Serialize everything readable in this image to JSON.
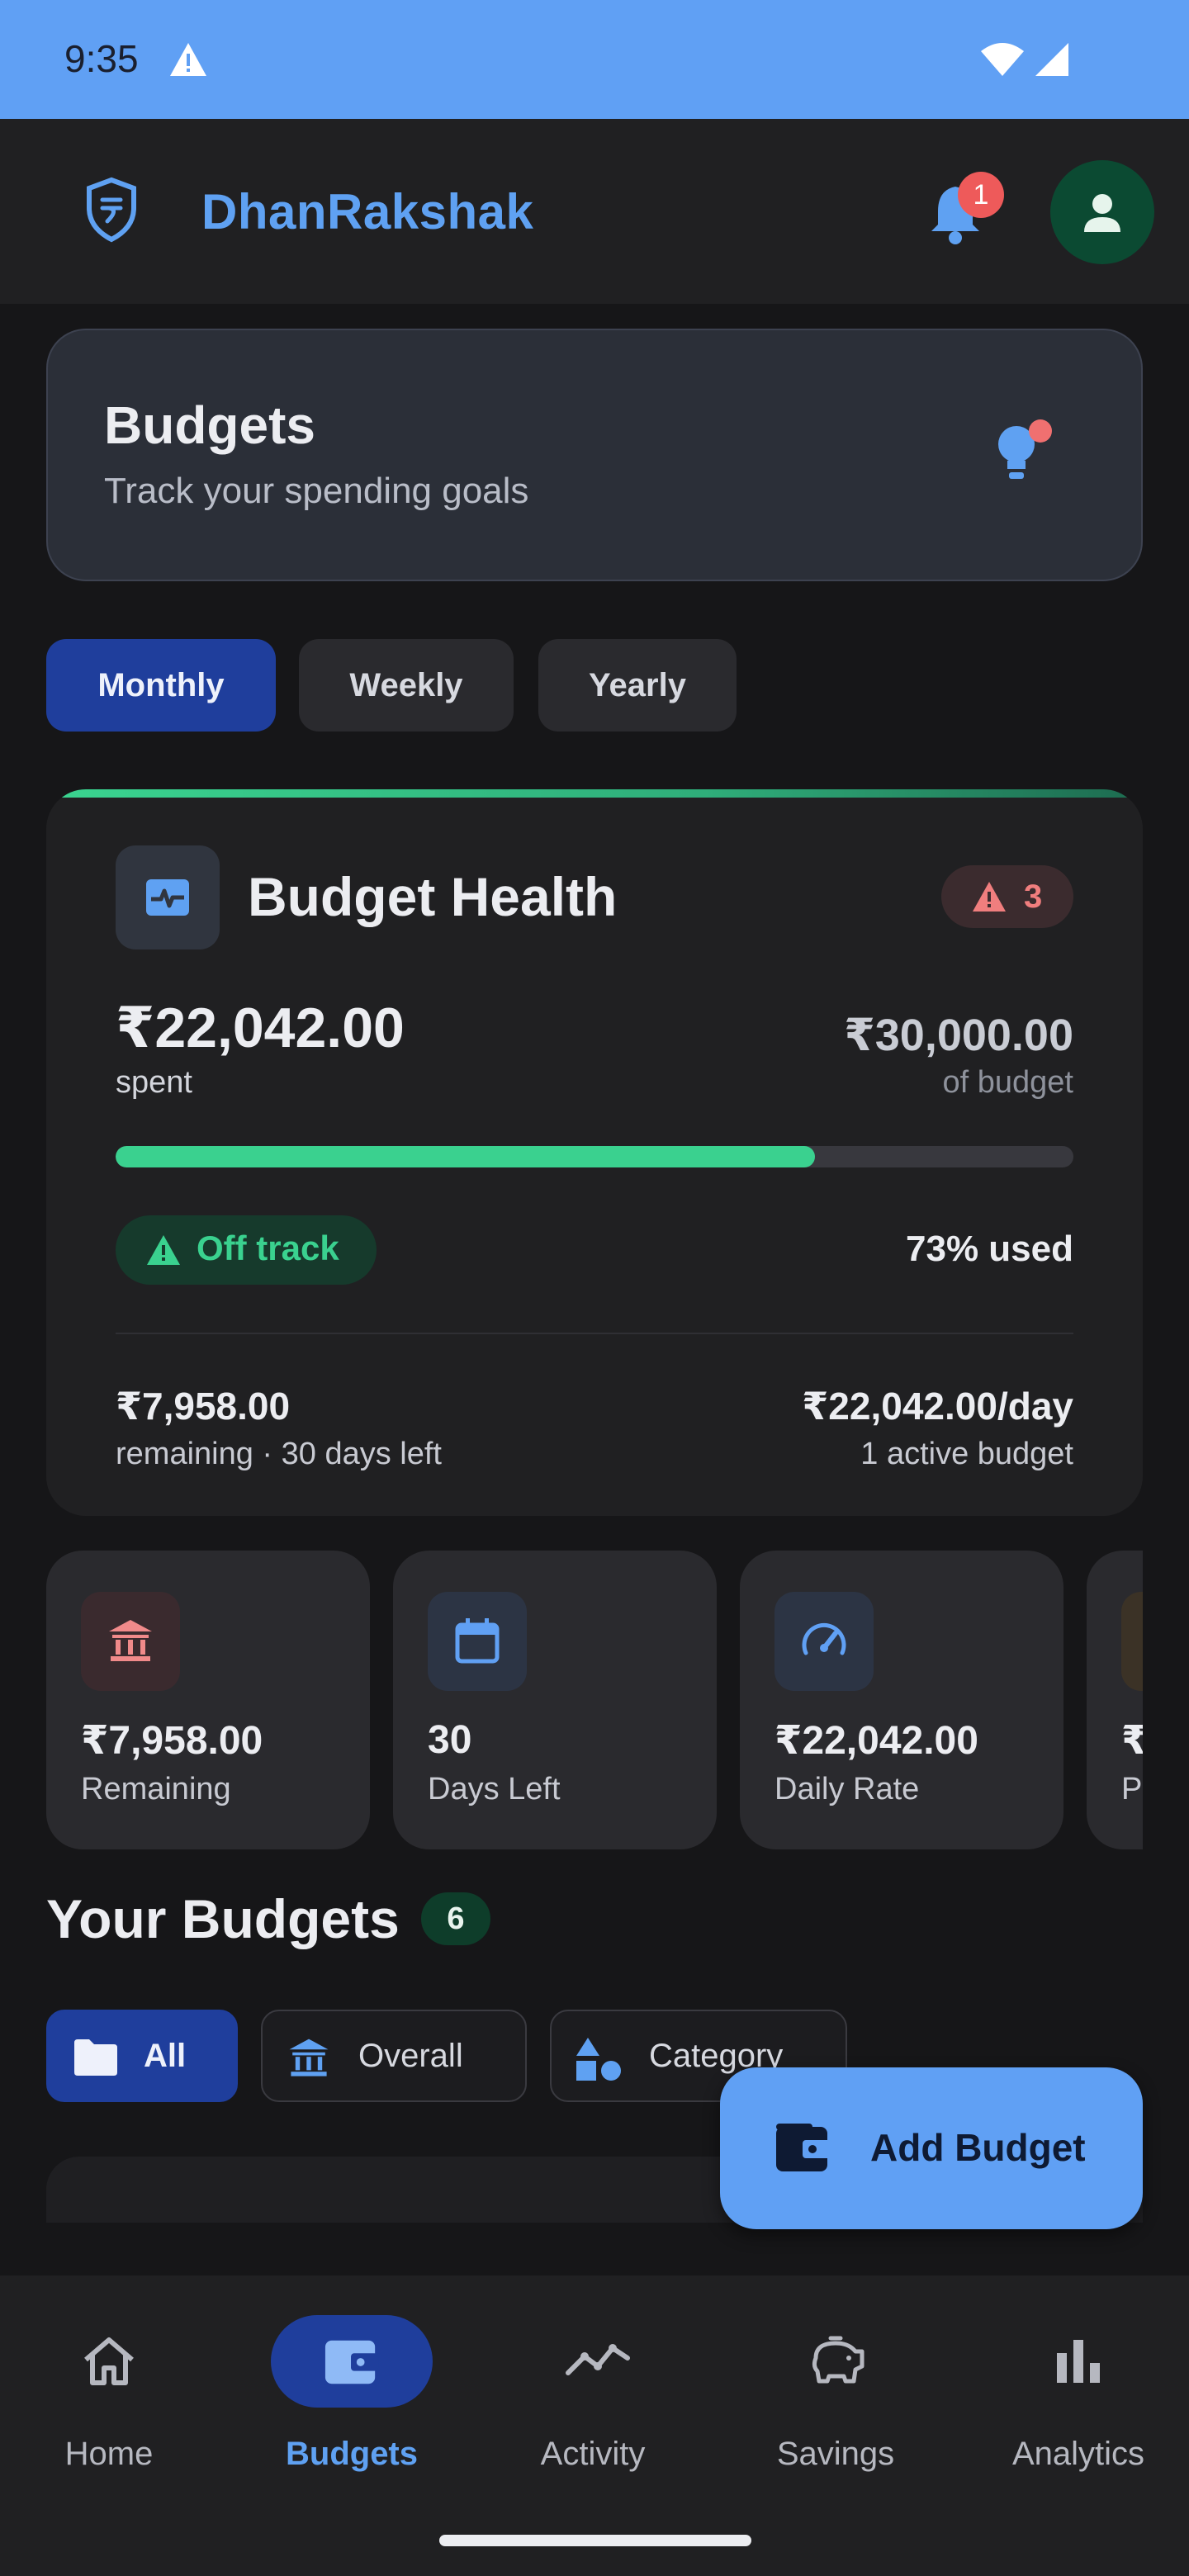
{
  "status_bar": {
    "time": "9:35"
  },
  "app": {
    "title": "DhanRakshak",
    "notification_count": "1"
  },
  "header": {
    "title": "Budgets",
    "subtitle": "Track your spending goals"
  },
  "period_tabs": [
    {
      "label": "Monthly",
      "active": true
    },
    {
      "label": "Weekly",
      "active": false
    },
    {
      "label": "Yearly",
      "active": false
    }
  ],
  "health": {
    "title": "Budget Health",
    "alert_count": "3",
    "spent": "₹22,042.00",
    "spent_label": "spent",
    "budget": "₹30,000.00",
    "budget_label": "of budget",
    "progress_fraction": 0.73,
    "status": "Off track",
    "used": "73% used",
    "remaining": "₹7,958.00",
    "remaining_sub": "remaining · 30 days left",
    "daily_rate": "₹22,042.00/day",
    "active_budgets": "1 active budget"
  },
  "stats": [
    {
      "value": "₹7,958.00",
      "label": "Remaining",
      "icon": "bank-icon",
      "bg": "#3a2a2e",
      "color": "#f08a8a"
    },
    {
      "value": "30",
      "label": "Days Left",
      "icon": "calendar-icon",
      "bg": "#2c3444",
      "color": "#60a0f4"
    },
    {
      "value": "₹22,042.00",
      "label": "Daily Rate",
      "icon": "speedometer-icon",
      "bg": "#2c3444",
      "color": "#60a0f4"
    },
    {
      "value": "₹",
      "label": "P",
      "icon": "misc-icon",
      "bg": "#3b3226",
      "color": "#e0a040"
    }
  ],
  "your_budgets": {
    "title": "Your Budgets",
    "count": "6"
  },
  "filters": [
    {
      "label": "All",
      "active": true
    },
    {
      "label": "Overall",
      "active": false
    },
    {
      "label": "Category",
      "active": false
    }
  ],
  "fab": {
    "label": "Add Budget"
  },
  "nav": [
    {
      "label": "Home",
      "active": false
    },
    {
      "label": "Budgets",
      "active": true
    },
    {
      "label": "Activity",
      "active": false
    },
    {
      "label": "Savings",
      "active": false
    },
    {
      "label": "Analytics",
      "active": false
    }
  ],
  "colors": {
    "accent": "#60a0f4",
    "success": "#3ad18f",
    "danger": "#ee5a5a",
    "active_chip": "#1f3e9c"
  }
}
